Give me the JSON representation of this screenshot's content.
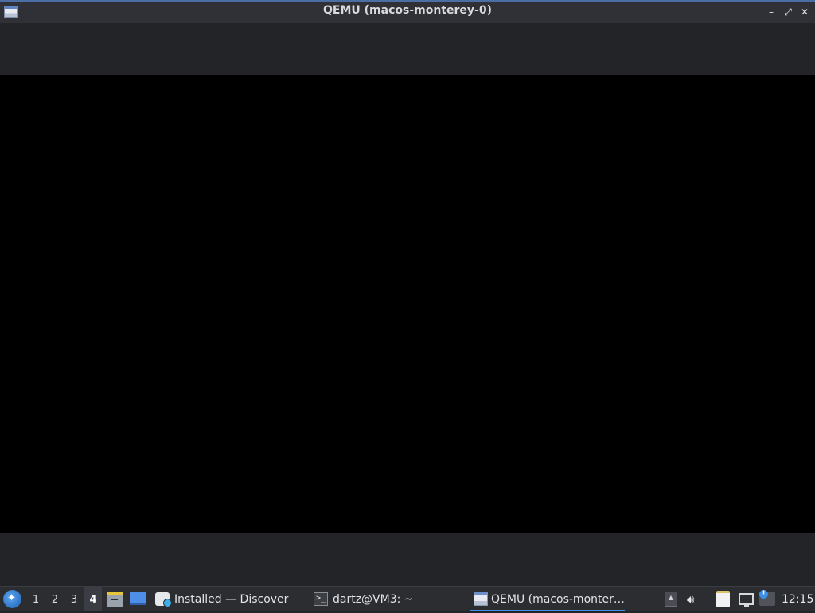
{
  "window": {
    "title": "QEMU (macos-monterey-0)",
    "controls": {
      "minimize": "–",
      "maximize": "⤢",
      "close": "✕"
    }
  },
  "taskbar": {
    "desktops": [
      "1",
      "2",
      "3",
      "4"
    ],
    "active_desktop": "4",
    "tasks": [
      {
        "label": "Installed — Discover",
        "icon": "discover-icon"
      },
      {
        "label": "dartz@VM3: ~",
        "icon": "terminal-icon"
      },
      {
        "label": "QEMU (macos-monter…",
        "icon": "qemu-icon",
        "active": true
      }
    ],
    "clock": "12:15"
  },
  "colors": {
    "titlebar_bg": "#2f3136",
    "title_accent": "#4b6ea5",
    "panel_bg": "#2b2d31",
    "display_bg": "#000000",
    "active_accent": "#3d8ee6"
  }
}
